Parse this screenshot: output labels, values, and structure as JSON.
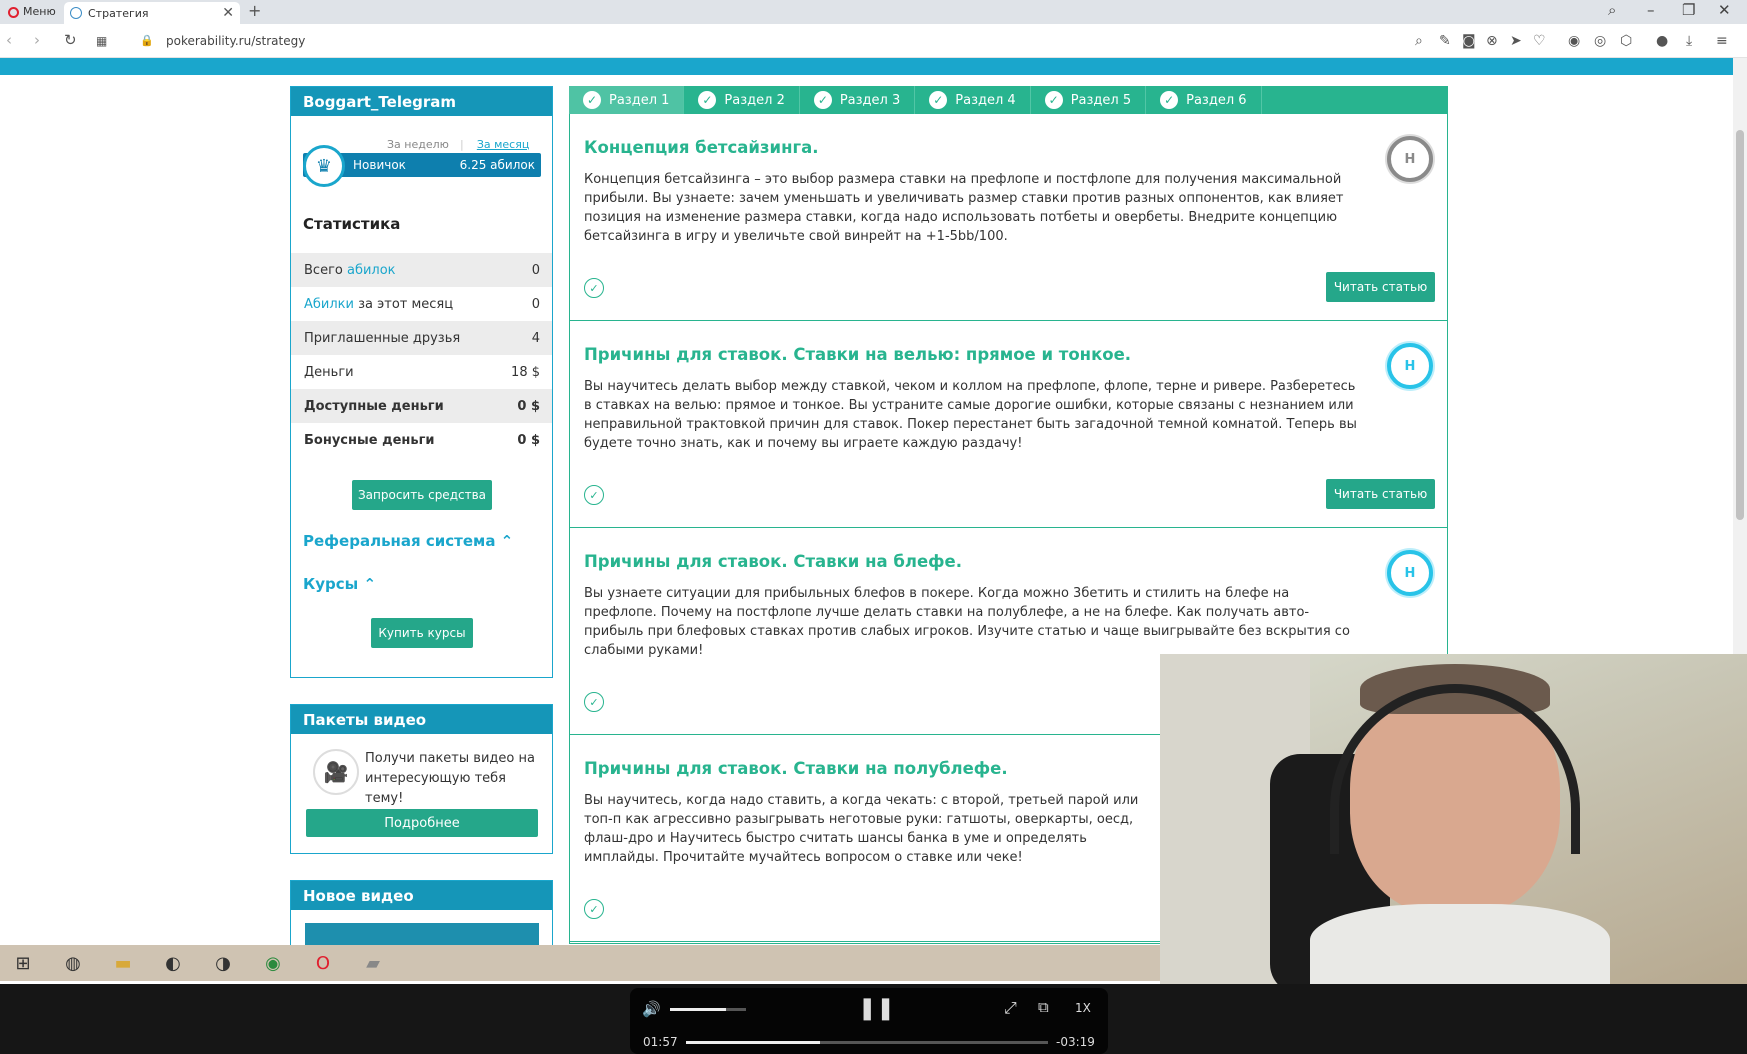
{
  "browser": {
    "menu_label": "Меню",
    "tab_title": "Стратегия",
    "url": "pokerability.ru/strategy"
  },
  "sidebar": {
    "username": "Boggart_Telegram",
    "period_week": "За неделю",
    "period_month": "За месяц",
    "rank": "Новичок",
    "rank_points": "6.25 абилок",
    "stats_title": "Статистика",
    "stats": [
      {
        "label_pre": "Всего ",
        "label_link": "абилок",
        "label_post": "",
        "value": "0"
      },
      {
        "label_pre": "",
        "label_link": "Абилки",
        "label_post": " за этот месяц",
        "value": "0"
      },
      {
        "label_pre": "Приглашенные друзья",
        "label_link": "",
        "label_post": "",
        "value": "4"
      },
      {
        "label_pre": "Деньги",
        "label_link": "",
        "label_post": "",
        "value": "18 $"
      },
      {
        "label_pre": "Доступные деньги",
        "label_link": "",
        "label_post": "",
        "value": "0 $"
      },
      {
        "label_pre": "Бонусные деньги",
        "label_link": "",
        "label_post": "",
        "value": "0 $"
      }
    ],
    "request_funds_button": "Запросить средства",
    "referral_label": "Реферальная система",
    "courses_label": "Курсы",
    "buy_courses_button": "Купить курсы",
    "video_packs_title": "Пакеты видео",
    "video_packs_text": "Получи пакеты видео на интересующую тебя тему!",
    "details_button": "Подробнее",
    "new_video_title": "Новое видео"
  },
  "sections": [
    "Раздел 1",
    "Раздел 2",
    "Раздел 3",
    "Раздел 4",
    "Раздел 5",
    "Раздел 6"
  ],
  "articles": [
    {
      "title": "Концепция бетсайзинга.",
      "text": "Концепция бетсайзинга – это выбор размера ставки на префлопе и постфлопе для получения максимальной прибыли. Вы узнаете: зачем уменьшать и увеличивать размер ставки против разных оппонентов, как влияет позиция на изменение размера ставки, когда надо использовать потбеты и овербеты. Внедрите концепцию бетсайзинга в игру и увеличьте свой винрейт на +1-5bb/100.",
      "badge": "Н",
      "button": "Читать статью"
    },
    {
      "title": "Причины для ставок. Ставки на велью: прямое и тонкое.",
      "text": "Вы научитесь делать выбор между ставкой, чеком и коллом на префлопе, флопе, терне и ривере. Разберетесь в ставках на велью: прямое и тонкое. Вы устраните самые дорогие ошибки, которые связаны с незнанием или неправильной трактовкой причин для ставок. Покер перестанет быть загадочной темной комнатой. Теперь вы будете точно знать, как и почему вы играете каждую раздачу!",
      "badge": "Н",
      "button": "Читать статью"
    },
    {
      "title": "Причины для ставок. Ставки на блефе.",
      "text": "Вы узнаете ситуации для прибыльных блефов в покере. Когда можно 3бетить и стилить на блефе на префлопе. Почему на постфлопе лучше делать ставки на полублефе, а не на блефе. Как получать авто-прибыль при блефовых ставках против слабых игроков. Изучите статью и чаще выигрывайте без вскрытия со слабыми руками!",
      "badge": "Н"
    },
    {
      "title": "Причины для ставок. Ставки на полублефе.",
      "text": "Вы научитесь, когда надо ставить, а когда чекать: с второй, третьей парой или топ-п как агрессивно разыгрывать неготовые руки: гатшоты, оверкарты, оесд, флаш-дро и Научитесь быстро считать шансы банка в уме и определять имплайды. Прочитайте мучайтесь вопросом о ставке или чеке!"
    }
  ],
  "player": {
    "elapsed": "01:57",
    "remaining": "-03:19",
    "speed": "1X",
    "progress": 0.37,
    "volume": 0.74
  }
}
